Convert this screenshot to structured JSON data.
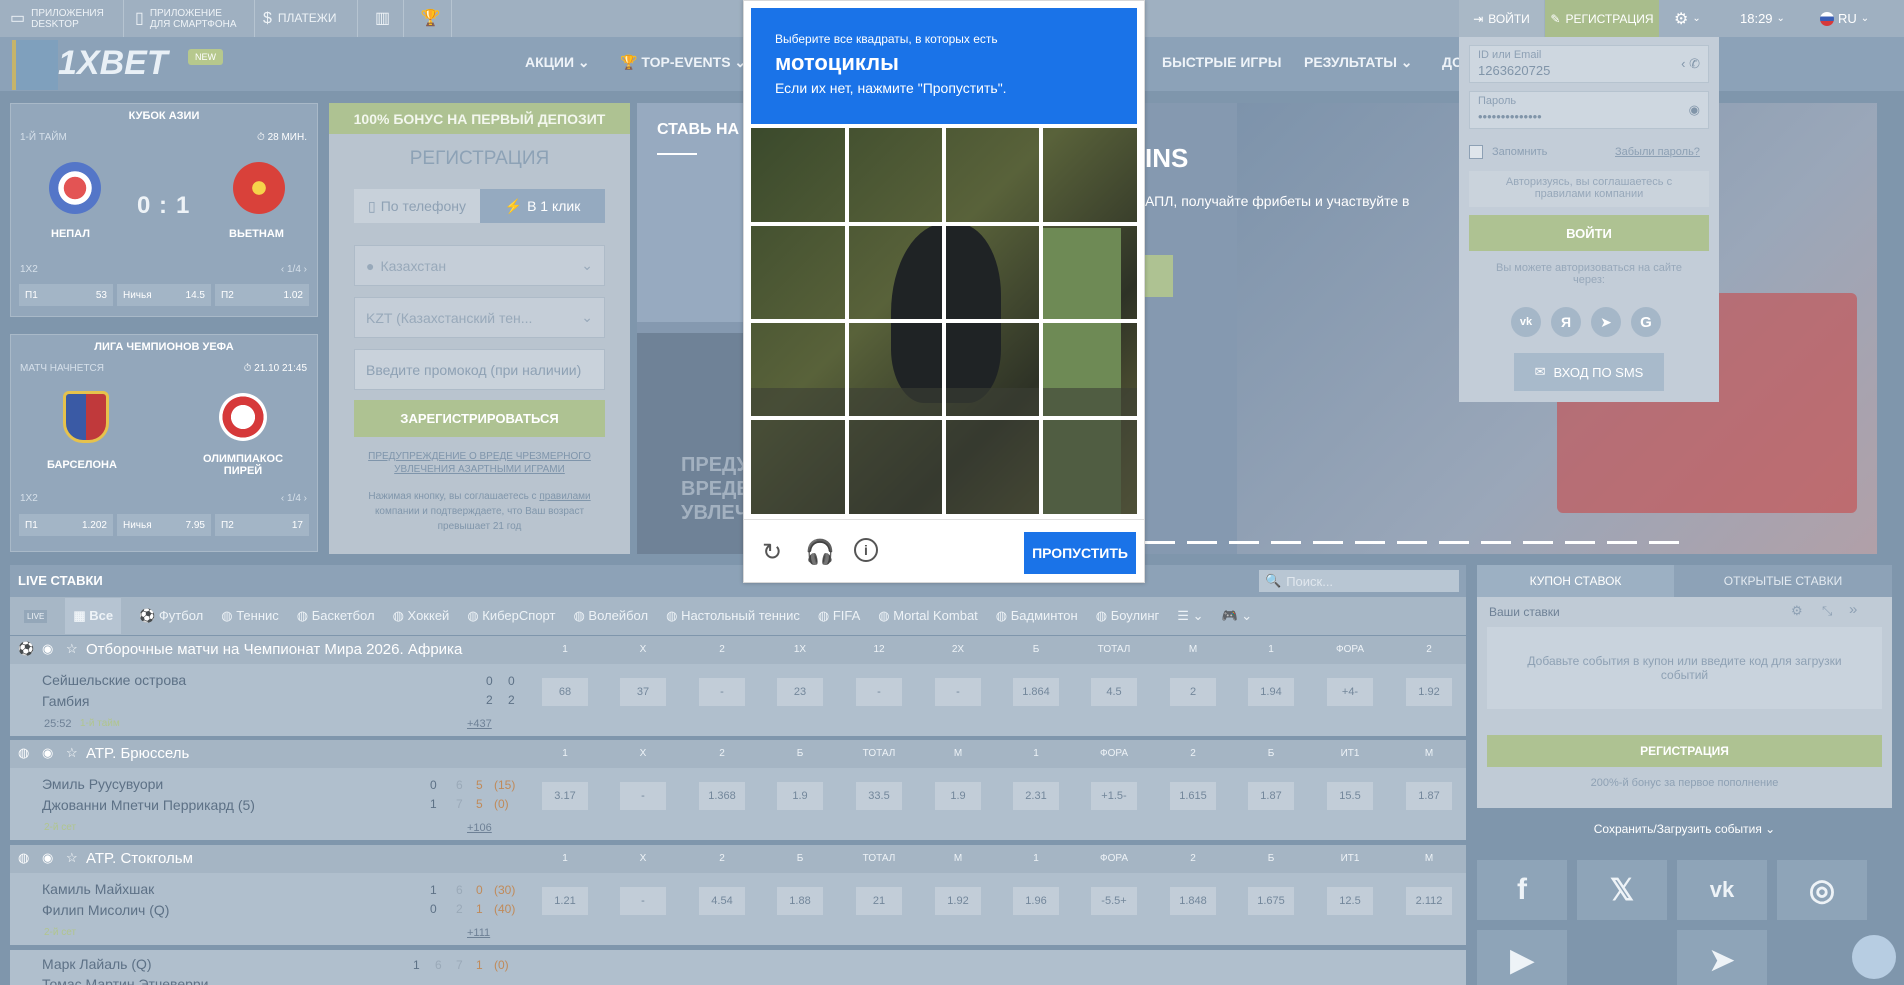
{
  "topbar": {
    "desktop_app": "ПРИЛОЖЕНИЯ DESKTOP",
    "mobile_app": "ПРИЛОЖЕНИЕ ДЛЯ СМАРТФОНА",
    "payments": "ПЛАТЕЖИ",
    "login": "ВОЙТИ",
    "register": "РЕГИСТРАЦИЯ",
    "time": "18:29",
    "lang": "RU"
  },
  "nav": {
    "logo": "1XBET",
    "new_badge": "NEW",
    "items": [
      "АКЦИИ",
      "TOP-EVENTS",
      "БЫСТРЫЕ ИГРЫ",
      "РЕЗУЛЬТАТЫ",
      "ДО"
    ]
  },
  "card1": {
    "title": "КУБОК АЗИИ",
    "period": "1-Й ТАЙМ",
    "minute": "28 МИН.",
    "team1": "НЕПАЛ",
    "team2": "ВЬЕТНАМ",
    "score1": "0",
    "score2": "1",
    "market": "1X2",
    "pager": "1/4",
    "odds": [
      {
        "label": "П1",
        "value": "53"
      },
      {
        "label": "Ничья",
        "value": "14.5"
      },
      {
        "label": "П2",
        "value": "1.02"
      }
    ]
  },
  "card2": {
    "title": "ЛИГА ЧЕМПИОНОВ УЕФА",
    "status": "МАТЧ НАЧНЕТСЯ",
    "datetime": "21.10 21:45",
    "team1": "БАРСЕЛОНА",
    "team2": "ОЛИМПИАКОС ПИРЕЙ",
    "market": "1X2",
    "pager": "1/4",
    "odds": [
      {
        "label": "П1",
        "value": "1.202"
      },
      {
        "label": "Ничья",
        "value": "7.95"
      },
      {
        "label": "П2",
        "value": "17"
      }
    ]
  },
  "registration": {
    "bonus": "100% БОНУС НА ПЕРВЫЙ ДЕПОЗИТ",
    "title": "РЕГИСТРАЦИЯ",
    "tab_phone": "По телефону",
    "tab_oneclick": "В 1 клик",
    "country": "Казахстан",
    "currency": "KZT (Казахстанский тен...",
    "promo_placeholder": "Введите промокод (при наличии)",
    "submit": "ЗАРЕГИСТРИРОВАТЬСЯ",
    "warning": "ПРЕДУПРЕЖДЕНИЕ О ВРЕДЕ ЧРЕЗМЕРНОГО УВЛЕЧЕНИЯ АЗАРТНЫМИ ИГРАМИ",
    "terms_1": "Нажимая кнопку, вы соглашаетесь с",
    "terms_link": "правилами",
    "terms_2": "компании и подтверждаете, что Ваш возраст превышает 21 год"
  },
  "banner": {
    "heading": "СТАВЬ НА",
    "wins": "INS",
    "text": "АПЛ, получайте фрибеты и участвуйте в",
    "warning_1": "ПРЕДУ",
    "warning_2": "ВРЕДЕ",
    "warning_3": "УВЛЕЧЕ"
  },
  "login_popup": {
    "id_label": "ID или Email",
    "id_value": "1263620725",
    "password_label": "Пароль",
    "password_value": "••••••••••••••",
    "remember": "Запомнить",
    "forgot": "Забыли пароль?",
    "agreement": "Авторизуясь, вы соглашаетесь с правилами компании",
    "submit": "ВОЙТИ",
    "social_hint": "Вы можете авторизоваться на сайте через:",
    "sms": "ВХОД ПО SMS"
  },
  "captcha": {
    "instruction": "Выберите все квадраты, в которых есть",
    "object": "мотоциклы",
    "hint": "Если их нет, нажмите \"Пропустить\".",
    "skip": "ПРОПУСТИТЬ"
  },
  "live": {
    "title": "LIVE СТАВКИ",
    "search_placeholder": "Поиск...",
    "tabs": [
      "Все",
      "Футбол",
      "Теннис",
      "Баскетбол",
      "Хоккей",
      "КиберСпорт",
      "Волейбол",
      "Настольный теннис",
      "FIFA",
      "Mortal Kombat",
      "Бадминтон",
      "Боулинг"
    ],
    "sections": [
      {
        "title": "Отборочные матчи на Чемпионат Мира 2026. Африка",
        "cols": [
          "1",
          "X",
          "2",
          "1X",
          "12",
          "2X",
          "Б",
          "ТОТАЛ",
          "М",
          "1",
          "ФОРА",
          "2"
        ],
        "match": {
          "team1": "Сейшельские острова",
          "team2": "Гамбия",
          "s1": [
            "0",
            "0"
          ],
          "s2": [
            "2",
            "2"
          ],
          "time": "25:52",
          "period": "1-й тайм",
          "more": "+437",
          "odds": [
            "68",
            "37",
            "-",
            "23",
            "-",
            "-",
            "1.864",
            "4.5",
            "2",
            "1.94",
            "+4-",
            "1.92"
          ]
        }
      },
      {
        "title": "ATP. Брюссель",
        "cols": [
          "1",
          "X",
          "2",
          "Б",
          "ТОТАЛ",
          "М",
          "1",
          "ФОРА",
          "2",
          "Б",
          "ИТ1",
          "М"
        ],
        "match": {
          "team1": "Эмиль Руусувуори",
          "team2": "Джованни Мпетчи Перрикард (5)",
          "s1": [
            "0",
            "6",
            "5",
            "(15)"
          ],
          "s2": [
            "1",
            "7",
            "5",
            "(0)"
          ],
          "period": "2-й сет",
          "more": "+106",
          "odds": [
            "3.17",
            "-",
            "1.368",
            "1.9",
            "33.5",
            "1.9",
            "2.31",
            "+1.5-",
            "1.615",
            "1.87",
            "15.5",
            "1.87"
          ]
        }
      },
      {
        "title": "ATP. Стокгольм",
        "cols": [
          "1",
          "X",
          "2",
          "Б",
          "ТОТАЛ",
          "М",
          "1",
          "ФОРА",
          "2",
          "Б",
          "ИТ1",
          "М"
        ],
        "match": {
          "team1": "Камиль Майхшак",
          "team2": "Филип Мисолич (Q)",
          "s1": [
            "1",
            "6",
            "0",
            "(30)"
          ],
          "s2": [
            "0",
            "2",
            "1",
            "(40)"
          ],
          "period": "2-й сет",
          "more": "+111",
          "odds": [
            "1.21",
            "-",
            "4.54",
            "1.88",
            "21",
            "1.92",
            "1.96",
            "-5.5+",
            "1.848",
            "1.675",
            "12.5",
            "2.112"
          ]
        }
      }
    ],
    "partial_team1": "Марк Лайаль (Q)",
    "partial_team2": "Томас Мартин Этчеверри",
    "partial_s1": [
      "1",
      "6",
      "7",
      "1",
      "(0)"
    ]
  },
  "coupon": {
    "tab1": "КУПОН СТАВОК",
    "tab2": "ОТКРЫТЫЕ СТАВКИ",
    "your_bets": "Ваши ставки",
    "empty": "Добавьте события в купон или введите код для загрузки событий",
    "register": "РЕГИСТРАЦИЯ",
    "bonus": "200%-й бонус за первое пополнение",
    "save_load": "Сохранить/Загрузить события"
  }
}
